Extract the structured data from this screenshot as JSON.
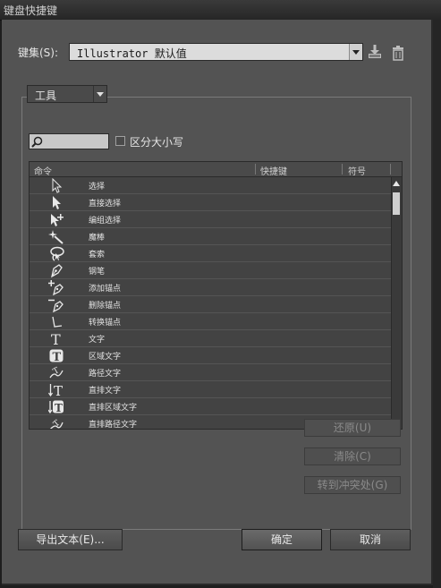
{
  "window": {
    "title": "键盘快捷键"
  },
  "keyset": {
    "label": "键集(S):",
    "value": "Illustrator 默认值",
    "save_icon": "download-icon",
    "delete_icon": "trash-icon"
  },
  "category": {
    "value": "工具"
  },
  "search": {
    "value": "",
    "icon": "search-icon"
  },
  "case_checkbox": {
    "label": "区分大小写",
    "checked": false
  },
  "table": {
    "columns": [
      "命令",
      "快捷键",
      "符号"
    ],
    "rows": [
      {
        "name": "选择",
        "icon": "selection-arrow-icon"
      },
      {
        "name": "直接选择",
        "icon": "direct-selection-icon"
      },
      {
        "name": "编组选择",
        "icon": "group-selection-icon"
      },
      {
        "name": "魔棒",
        "icon": "magic-wand-icon"
      },
      {
        "name": "套索",
        "icon": "lasso-icon"
      },
      {
        "name": "钢笔",
        "icon": "pen-icon"
      },
      {
        "name": "添加锚点",
        "icon": "add-anchor-icon"
      },
      {
        "name": "删除锚点",
        "icon": "delete-anchor-icon"
      },
      {
        "name": "转换锚点",
        "icon": "convert-anchor-icon"
      },
      {
        "name": "文字",
        "icon": "type-icon"
      },
      {
        "name": "区域文字",
        "icon": "area-type-icon"
      },
      {
        "name": "路径文字",
        "icon": "path-type-icon"
      },
      {
        "name": "直排文字",
        "icon": "vertical-type-icon"
      },
      {
        "name": "直排区域文字",
        "icon": "vertical-area-type-icon"
      },
      {
        "name": "直排路径文字",
        "icon": "vertical-path-type-icon"
      }
    ]
  },
  "buttons": {
    "undo": "还原(U)",
    "clear": "清除(C)",
    "goto_conflict": "转到冲突处(G)",
    "export_text": "导出文本(E)...",
    "ok": "确定",
    "cancel": "取消"
  }
}
